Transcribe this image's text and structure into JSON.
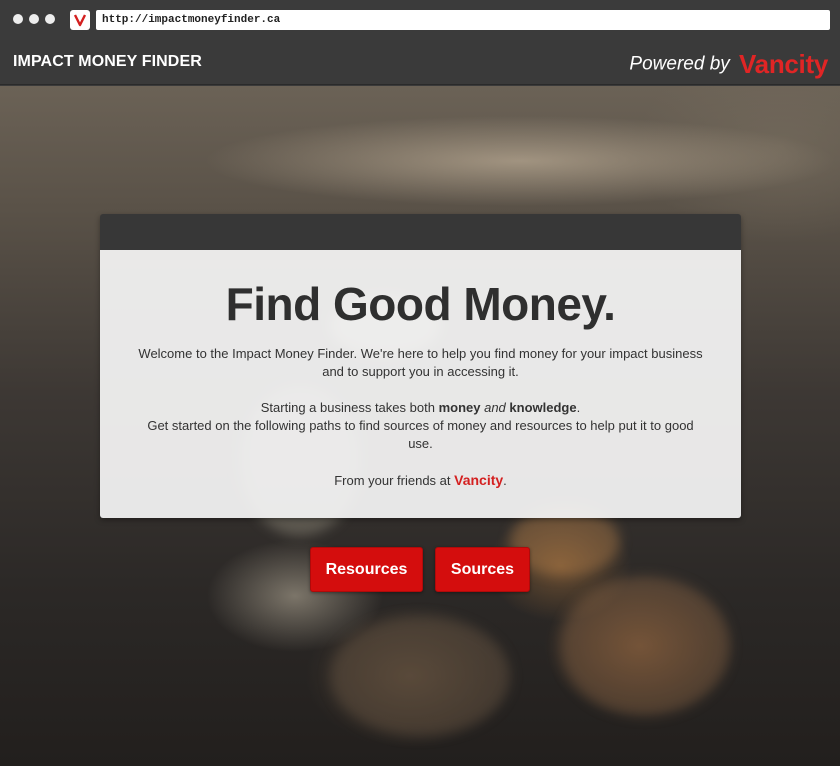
{
  "browser": {
    "url": "http://impactmoneyfinder.ca",
    "favicon_letter": "V"
  },
  "header": {
    "brand": "IMPACT MONEY FINDER",
    "powered_by": "Powered by",
    "partner": "Vancity"
  },
  "card": {
    "headline": "Find Good Money.",
    "welcome_line1": "Welcome to the Impact Money Finder. We're here to help you find money for your impact business",
    "welcome_line2": "and to support you in accessing it.",
    "start_prefix": "Starting a business takes both",
    "start_money": "money",
    "start_and": "and",
    "start_knowledge": "knowledge",
    "start_suffix": ".",
    "paths_line1": "Get started on the following paths to find sources of money and resources to help put it to good",
    "paths_line2": "use.",
    "friends_prefix": "From your friends at",
    "friends_name": "Vancity",
    "friends_suffix": "."
  },
  "buttons": {
    "resources": "Resources",
    "sources": "Sources"
  },
  "colors": {
    "accent": "#d40d0d",
    "header_bg": "#3a3a3a",
    "brand_red": "#e02525"
  }
}
